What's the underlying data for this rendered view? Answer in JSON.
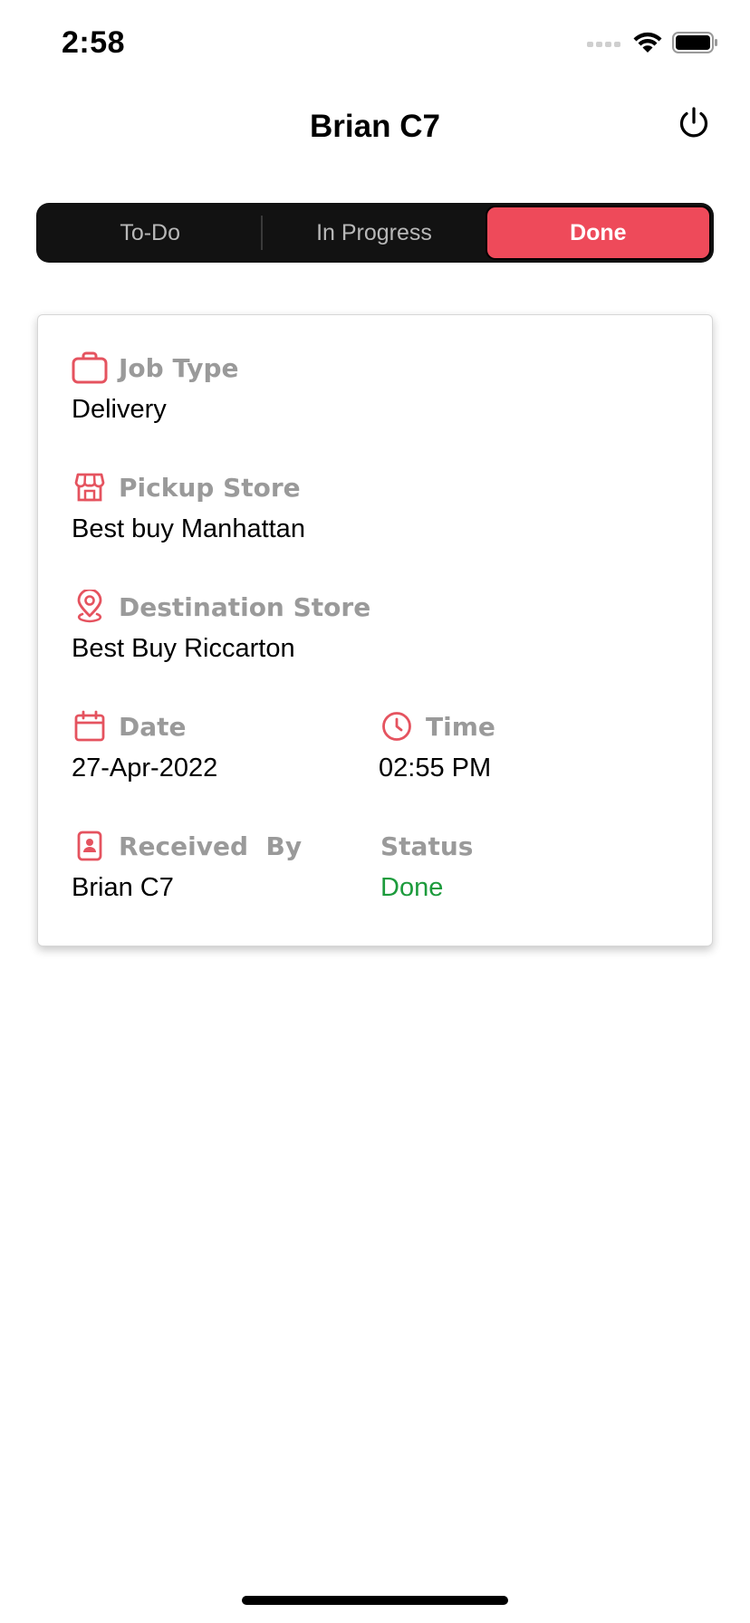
{
  "status_bar": {
    "time": "2:58"
  },
  "header": {
    "title": "Brian C7",
    "power_icon": "power-icon"
  },
  "tabs": [
    {
      "label": "To-Do",
      "active": false
    },
    {
      "label": "In Progress",
      "active": false
    },
    {
      "label": "Done",
      "active": true
    }
  ],
  "colors": {
    "accent": "#ee4a5a",
    "segment_bg": "#121212",
    "label_gray": "#9a9a9a",
    "status_done": "#1c9b3c",
    "icon_red": "#e5535f"
  },
  "job": {
    "job_type": {
      "label": "Job Type",
      "value": "Delivery",
      "icon": "briefcase-icon"
    },
    "pickup_store": {
      "label": "Pickup Store",
      "value": "Best buy Manhattan",
      "icon": "store-icon"
    },
    "destination_store": {
      "label": "Destination Store",
      "value": "Best Buy Riccarton",
      "icon": "location-pin-icon"
    },
    "date": {
      "label": "Date",
      "value": "27-Apr-2022",
      "icon": "calendar-icon"
    },
    "time": {
      "label": "Time",
      "value": "02:55 PM",
      "icon": "clock-icon"
    },
    "received_by": {
      "label": "Received  By",
      "value": "Brian C7",
      "icon": "contact-icon"
    },
    "status": {
      "label": "Status",
      "value": "Done"
    }
  }
}
